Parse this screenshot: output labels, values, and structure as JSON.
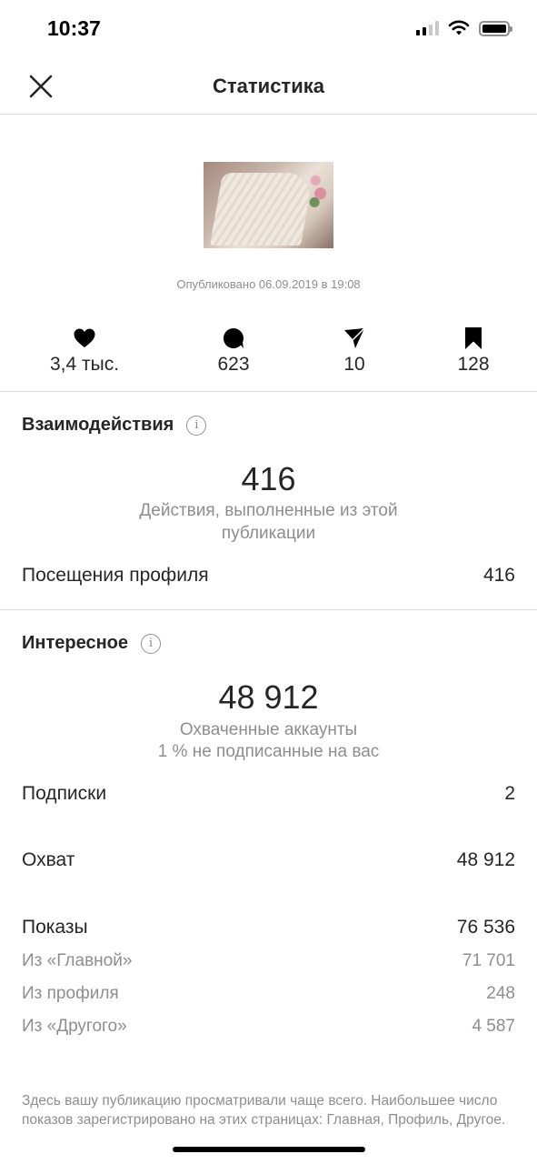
{
  "status_bar": {
    "time": "10:37"
  },
  "header": {
    "title": "Статистика"
  },
  "post": {
    "published": "Опубликовано 06.09.2019 в 19:08"
  },
  "metrics": [
    {
      "icon": "heart-icon",
      "value": "3,4 тыс."
    },
    {
      "icon": "comment-icon",
      "value": "623"
    },
    {
      "icon": "share-icon",
      "value": "10"
    },
    {
      "icon": "bookmark-icon",
      "value": "128"
    }
  ],
  "interactions": {
    "title": "Взаимодействия",
    "total": "416",
    "description": "Действия, выполненные из этой публикации",
    "rows": [
      {
        "label": "Посещения профиля",
        "value": "416"
      }
    ]
  },
  "discovery": {
    "title": "Интересное",
    "total": "48 912",
    "description": "Охваченные аккаунты",
    "note": "1 % не подписанные на вас",
    "rows": [
      {
        "label": "Подписки",
        "value": "2"
      },
      {
        "label": "Охват",
        "value": "48 912"
      },
      {
        "label": "Показы",
        "value": "76 536"
      }
    ],
    "sub_rows": [
      {
        "label": "Из «Главной»",
        "value": "71 701"
      },
      {
        "label": "Из профиля",
        "value": "248"
      },
      {
        "label": "Из «Другого»",
        "value": "4 587"
      }
    ]
  },
  "footnote": "Здесь вашу публикацию просматривали чаще всего. Наибольшее число показов зарегистрировано на этих страницах: Главная, Профиль, Другое."
}
